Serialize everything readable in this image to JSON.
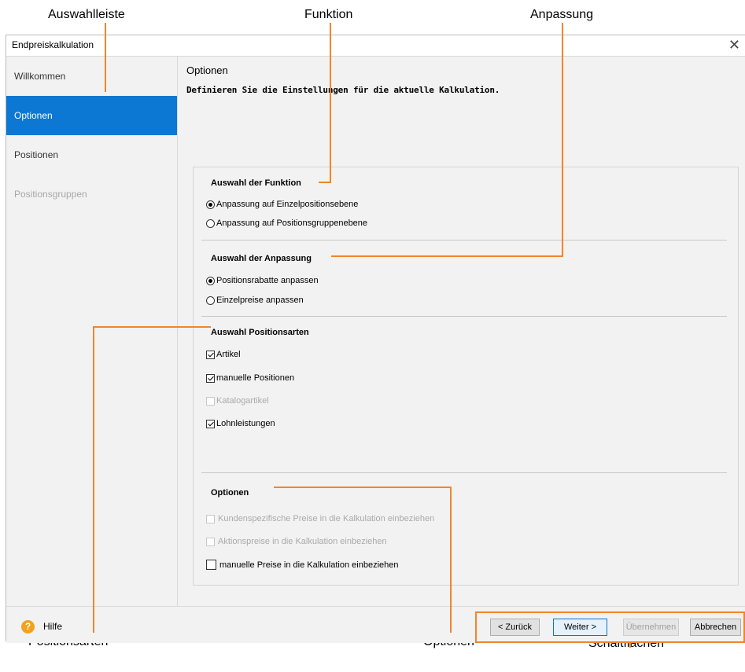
{
  "annotations": {
    "auswahlleiste": "Auswahlleiste",
    "funktion": "Funktion",
    "anpassung": "Anpassung",
    "positionsarten": "Positionsarten",
    "optionen": "Optionen",
    "schaltflaechen": "Schaltflächen"
  },
  "window": {
    "title": "Endpreiskalkulation",
    "close_glyph": "✕"
  },
  "sidebar": {
    "items": [
      {
        "label": "Willkommen"
      },
      {
        "label": "Optionen"
      },
      {
        "label": "Positionen"
      },
      {
        "label": "Positionsgruppen"
      }
    ]
  },
  "main": {
    "title": "Optionen",
    "description": "Definieren Sie die Einstellungen für die aktuelle Kalkulation."
  },
  "sections": {
    "funktion": {
      "title": "Auswahl der Funktion",
      "options": [
        {
          "label": "Anpassung auf Einzelpositionsebene",
          "selected": true
        },
        {
          "label": "Anpassung auf Positionsgruppenebene",
          "selected": false
        }
      ]
    },
    "anpassung": {
      "title": "Auswahl der Anpassung",
      "options": [
        {
          "label": "Positionsrabatte anpassen",
          "selected": true
        },
        {
          "label": "Einzelpreise anpassen",
          "selected": false
        }
      ]
    },
    "positionsarten": {
      "title": "Auswahl Positionsarten",
      "items": [
        {
          "label": "Artikel",
          "checked": true,
          "enabled": true
        },
        {
          "label": "manuelle Positionen",
          "checked": true,
          "enabled": true
        },
        {
          "label": "Katalogartikel",
          "checked": false,
          "enabled": false
        },
        {
          "label": "Lohnleistungen",
          "checked": true,
          "enabled": true
        }
      ]
    },
    "optionen": {
      "title": "Optionen",
      "items": [
        {
          "label": "Kundenspezifische Preise in die Kalkulation einbeziehen",
          "checked": false,
          "enabled": false
        },
        {
          "label": "Aktionspreise in die Kalkulation einbeziehen",
          "checked": false,
          "enabled": false
        },
        {
          "label": "manuelle Preise in die Kalkulation einbeziehen",
          "checked": false,
          "enabled": true
        }
      ]
    }
  },
  "footer": {
    "help_label": "Hilfe",
    "help_icon": "?",
    "buttons": {
      "back": "< Zurück",
      "next": "Weiter >",
      "apply": "Übernehmen",
      "cancel": "Abbrechen"
    }
  },
  "colors": {
    "accent": "#0c78d4",
    "annotation": "#f2852a",
    "help": "#f3a21b"
  }
}
